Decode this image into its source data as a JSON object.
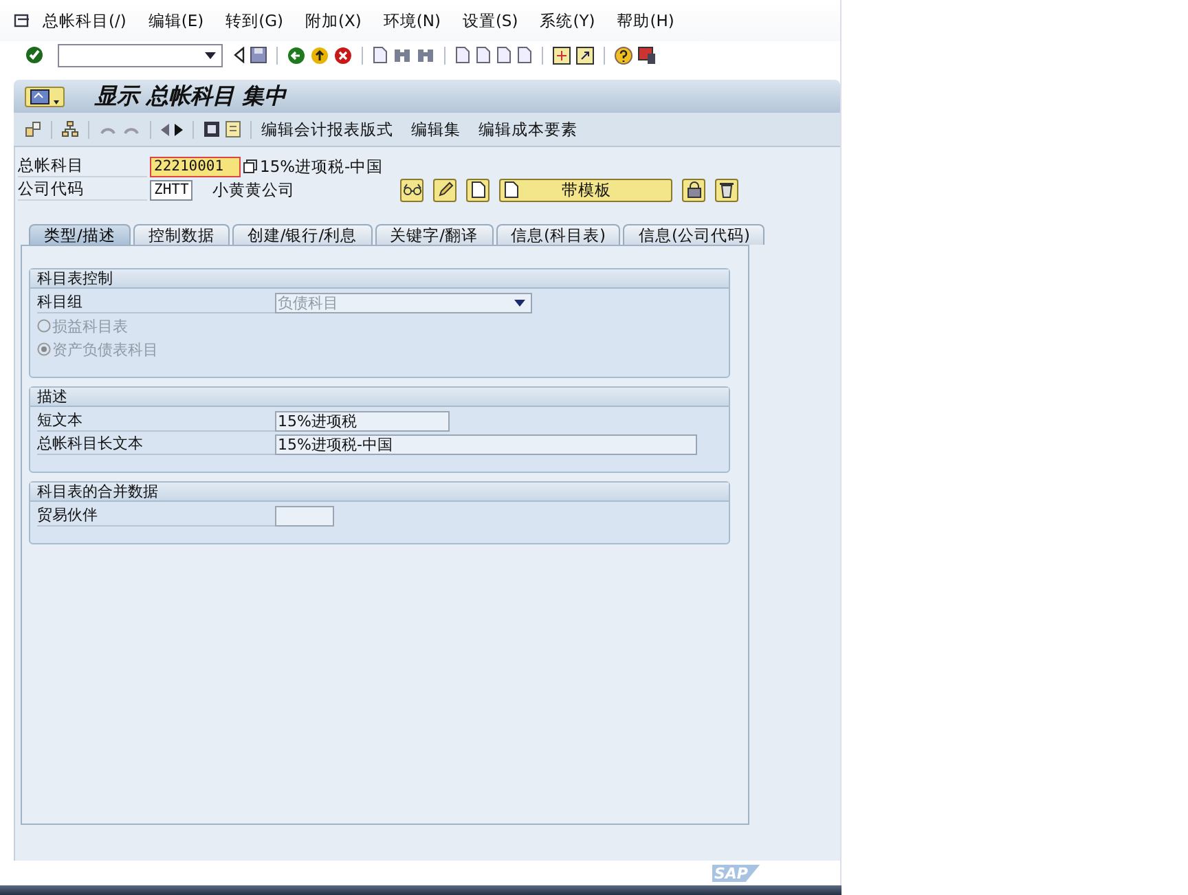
{
  "menu": [
    {
      "label": "总帐科目(/)"
    },
    {
      "label": "编辑(E)"
    },
    {
      "label": "转到(G)"
    },
    {
      "label": "附加(X)"
    },
    {
      "label": "环境(N)"
    },
    {
      "label": "设置(S)"
    },
    {
      "label": "系统(Y)"
    },
    {
      "label": "帮助(H)"
    }
  ],
  "title": "显示 总帐科目 集中",
  "app_toolbar": {
    "buttons": [
      "编辑会计报表版式",
      "编辑集",
      "编辑成本要素"
    ]
  },
  "header_fields": [
    {
      "label": "总帐科目",
      "value": "22210001",
      "description": "15%进项税-中国",
      "focused": true
    },
    {
      "label": "公司代码",
      "value": "ZHTT",
      "description": "小黄黄公司",
      "focused": false
    }
  ],
  "template_button": "带模板",
  "tabs": [
    {
      "label": "类型/描述",
      "selected": true
    },
    {
      "label": "控制数据",
      "selected": false
    },
    {
      "label": "创建/银行/利息",
      "selected": false
    },
    {
      "label": "关键字/翻译",
      "selected": false
    },
    {
      "label": "信息(科目表)",
      "selected": false
    },
    {
      "label": "信息(公司代码)",
      "selected": false
    }
  ],
  "groups": [
    {
      "title": "科目表控制",
      "rows": [
        {
          "kind": "dropdown",
          "label": "科目组",
          "value": "负债科目",
          "disabled": true
        },
        {
          "kind": "radio",
          "label": "损益科目表",
          "selected": false,
          "disabled": true
        },
        {
          "kind": "radio",
          "label": "资产负债表科目",
          "selected": true,
          "disabled": true
        }
      ]
    },
    {
      "title": "描述",
      "rows": [
        {
          "kind": "input",
          "label": "短文本",
          "value": "15%进项税"
        },
        {
          "kind": "input",
          "label": "总帐科目长文本",
          "value": "15%进项税-中国"
        }
      ]
    },
    {
      "title": "科目表的合并数据",
      "rows": [
        {
          "kind": "input",
          "label": "贸易伙伴"
        }
      ]
    }
  ],
  "logo": "SAP"
}
